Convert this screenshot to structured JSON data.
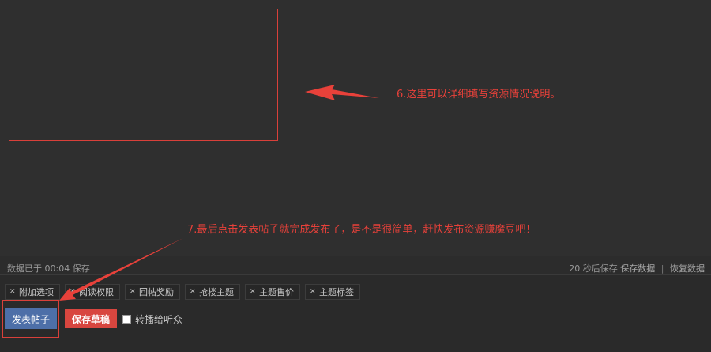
{
  "annotations": {
    "note6": "6.这里可以详细填写资源情况说明。",
    "note7": "7.最后点击发表帖子就完成发布了，是不是很简单，赶快发布资源赚魔豆吧！",
    "color": "#e8413a"
  },
  "status": {
    "left": "数据已于 00:04 保存",
    "autosave": "20 秒后保存",
    "save_data": "保存数据",
    "separator": "|",
    "restore_data": "恢复数据"
  },
  "tabs": [
    {
      "label": "附加选项",
      "icon": "close-icon"
    },
    {
      "label": "阅读权限",
      "icon": "close-icon"
    },
    {
      "label": "回帖奖励",
      "icon": "close-icon"
    },
    {
      "label": "抢楼主题",
      "icon": "close-icon"
    },
    {
      "label": "主题售价",
      "icon": "close-icon"
    },
    {
      "label": "主题标签",
      "icon": "close-icon"
    }
  ],
  "actions": {
    "publish": "发表帖子",
    "save_draft": "保存草稿",
    "broadcast": "转播给听众"
  },
  "colors": {
    "publish_button": "#4d6fa8",
    "draft_button": "#d8463f",
    "background": "#2a2a2a"
  }
}
